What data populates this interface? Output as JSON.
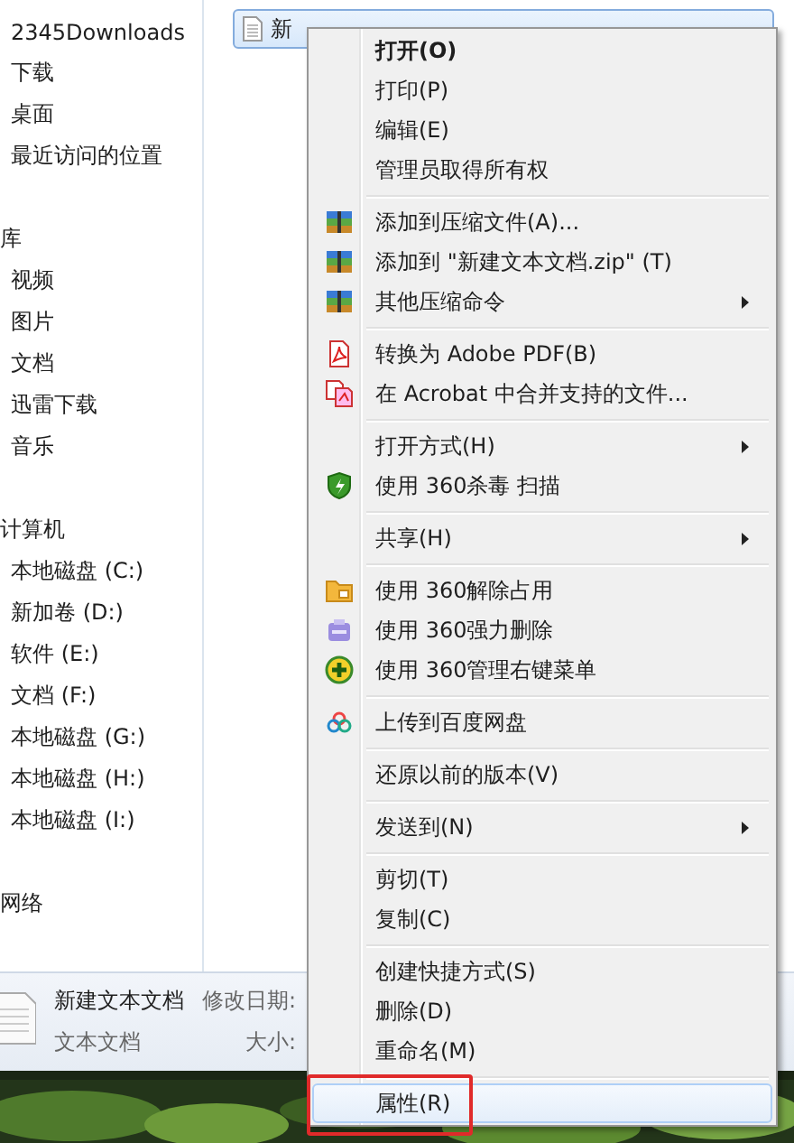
{
  "navigation": [
    {
      "label": "2345Downloads",
      "kind": "item"
    },
    {
      "label": "下载",
      "kind": "item"
    },
    {
      "label": "桌面",
      "kind": "item"
    },
    {
      "label": "最近访问的位置",
      "kind": "item"
    },
    {
      "label": "库",
      "kind": "header"
    },
    {
      "label": "视频",
      "kind": "item"
    },
    {
      "label": "图片",
      "kind": "item"
    },
    {
      "label": "文档",
      "kind": "item"
    },
    {
      "label": "迅雷下载",
      "kind": "item"
    },
    {
      "label": "音乐",
      "kind": "item"
    },
    {
      "label": "计算机",
      "kind": "header"
    },
    {
      "label": "本地磁盘 (C:)",
      "kind": "item"
    },
    {
      "label": "新加卷 (D:)",
      "kind": "item"
    },
    {
      "label": "软件 (E:)",
      "kind": "item"
    },
    {
      "label": "文档 (F:)",
      "kind": "item"
    },
    {
      "label": "本地磁盘 (G:)",
      "kind": "item"
    },
    {
      "label": "本地磁盘 (H:)",
      "kind": "item"
    },
    {
      "label": "本地磁盘 (I:)",
      "kind": "item"
    },
    {
      "label": "网络",
      "kind": "header"
    }
  ],
  "file": {
    "name": "新",
    "selected": true
  },
  "details": {
    "name": "新建文本文档",
    "type": "文本文档",
    "modified_label": "修改日期:",
    "size_label": "大小:"
  },
  "context_menu": [
    [
      {
        "label": "打开(O)",
        "kind": "plain",
        "default": true,
        "submenu": false,
        "selected": false,
        "outlined": false
      },
      {
        "label": "打印(P)",
        "kind": "plain",
        "default": false,
        "submenu": false,
        "selected": false,
        "outlined": false
      },
      {
        "label": "编辑(E)",
        "kind": "plain",
        "default": false,
        "submenu": false,
        "selected": false,
        "outlined": false
      },
      {
        "label": "管理员取得所有权",
        "kind": "plain",
        "default": false,
        "submenu": false,
        "selected": false,
        "outlined": false
      }
    ],
    [
      {
        "label": "添加到压缩文件(A)...",
        "kind": "archive",
        "default": false,
        "submenu": false,
        "selected": false,
        "outlined": false
      },
      {
        "label": "添加到 \"新建文本文档.zip\" (T)",
        "kind": "archive",
        "default": false,
        "submenu": false,
        "selected": false,
        "outlined": false
      },
      {
        "label": "其他压缩命令",
        "kind": "archive",
        "default": false,
        "submenu": true,
        "selected": false,
        "outlined": false
      }
    ],
    [
      {
        "label": "转换为 Adobe PDF(B)",
        "kind": "pdf",
        "default": false,
        "submenu": false,
        "selected": false,
        "outlined": false
      },
      {
        "label": "在 Acrobat 中合并支持的文件...",
        "kind": "pdf-merge",
        "default": false,
        "submenu": false,
        "selected": false,
        "outlined": false
      }
    ],
    [
      {
        "label": "打开方式(H)",
        "kind": "plain",
        "default": false,
        "submenu": true,
        "selected": false,
        "outlined": false
      },
      {
        "label": "使用 360杀毒 扫描",
        "kind": "shield",
        "default": false,
        "submenu": false,
        "selected": false,
        "outlined": false
      }
    ],
    [
      {
        "label": "共享(H)",
        "kind": "plain",
        "default": false,
        "submenu": true,
        "selected": false,
        "outlined": false
      }
    ],
    [
      {
        "label": "使用 360解除占用",
        "kind": "folder",
        "default": false,
        "submenu": false,
        "selected": false,
        "outlined": false
      },
      {
        "label": "使用 360强力删除",
        "kind": "shredder",
        "default": false,
        "submenu": false,
        "selected": false,
        "outlined": false
      },
      {
        "label": "使用 360管理右键菜单",
        "kind": "plus",
        "default": false,
        "submenu": false,
        "selected": false,
        "outlined": false
      }
    ],
    [
      {
        "label": "上传到百度网盘",
        "kind": "cloud",
        "default": false,
        "submenu": false,
        "selected": false,
        "outlined": false
      }
    ],
    [
      {
        "label": "还原以前的版本(V)",
        "kind": "plain",
        "default": false,
        "submenu": false,
        "selected": false,
        "outlined": false
      }
    ],
    [
      {
        "label": "发送到(N)",
        "kind": "plain",
        "default": false,
        "submenu": true,
        "selected": false,
        "outlined": false
      }
    ],
    [
      {
        "label": "剪切(T)",
        "kind": "plain",
        "default": false,
        "submenu": false,
        "selected": false,
        "outlined": false
      },
      {
        "label": "复制(C)",
        "kind": "plain",
        "default": false,
        "submenu": false,
        "selected": false,
        "outlined": false
      }
    ],
    [
      {
        "label": "创建快捷方式(S)",
        "kind": "plain",
        "default": false,
        "submenu": false,
        "selected": false,
        "outlined": false
      },
      {
        "label": "删除(D)",
        "kind": "plain",
        "default": false,
        "submenu": false,
        "selected": false,
        "outlined": false
      },
      {
        "label": "重命名(M)",
        "kind": "plain",
        "default": false,
        "submenu": false,
        "selected": false,
        "outlined": false
      }
    ],
    [
      {
        "label": "属性(R)",
        "kind": "plain",
        "default": false,
        "submenu": false,
        "selected": true,
        "outlined": true
      }
    ]
  ]
}
